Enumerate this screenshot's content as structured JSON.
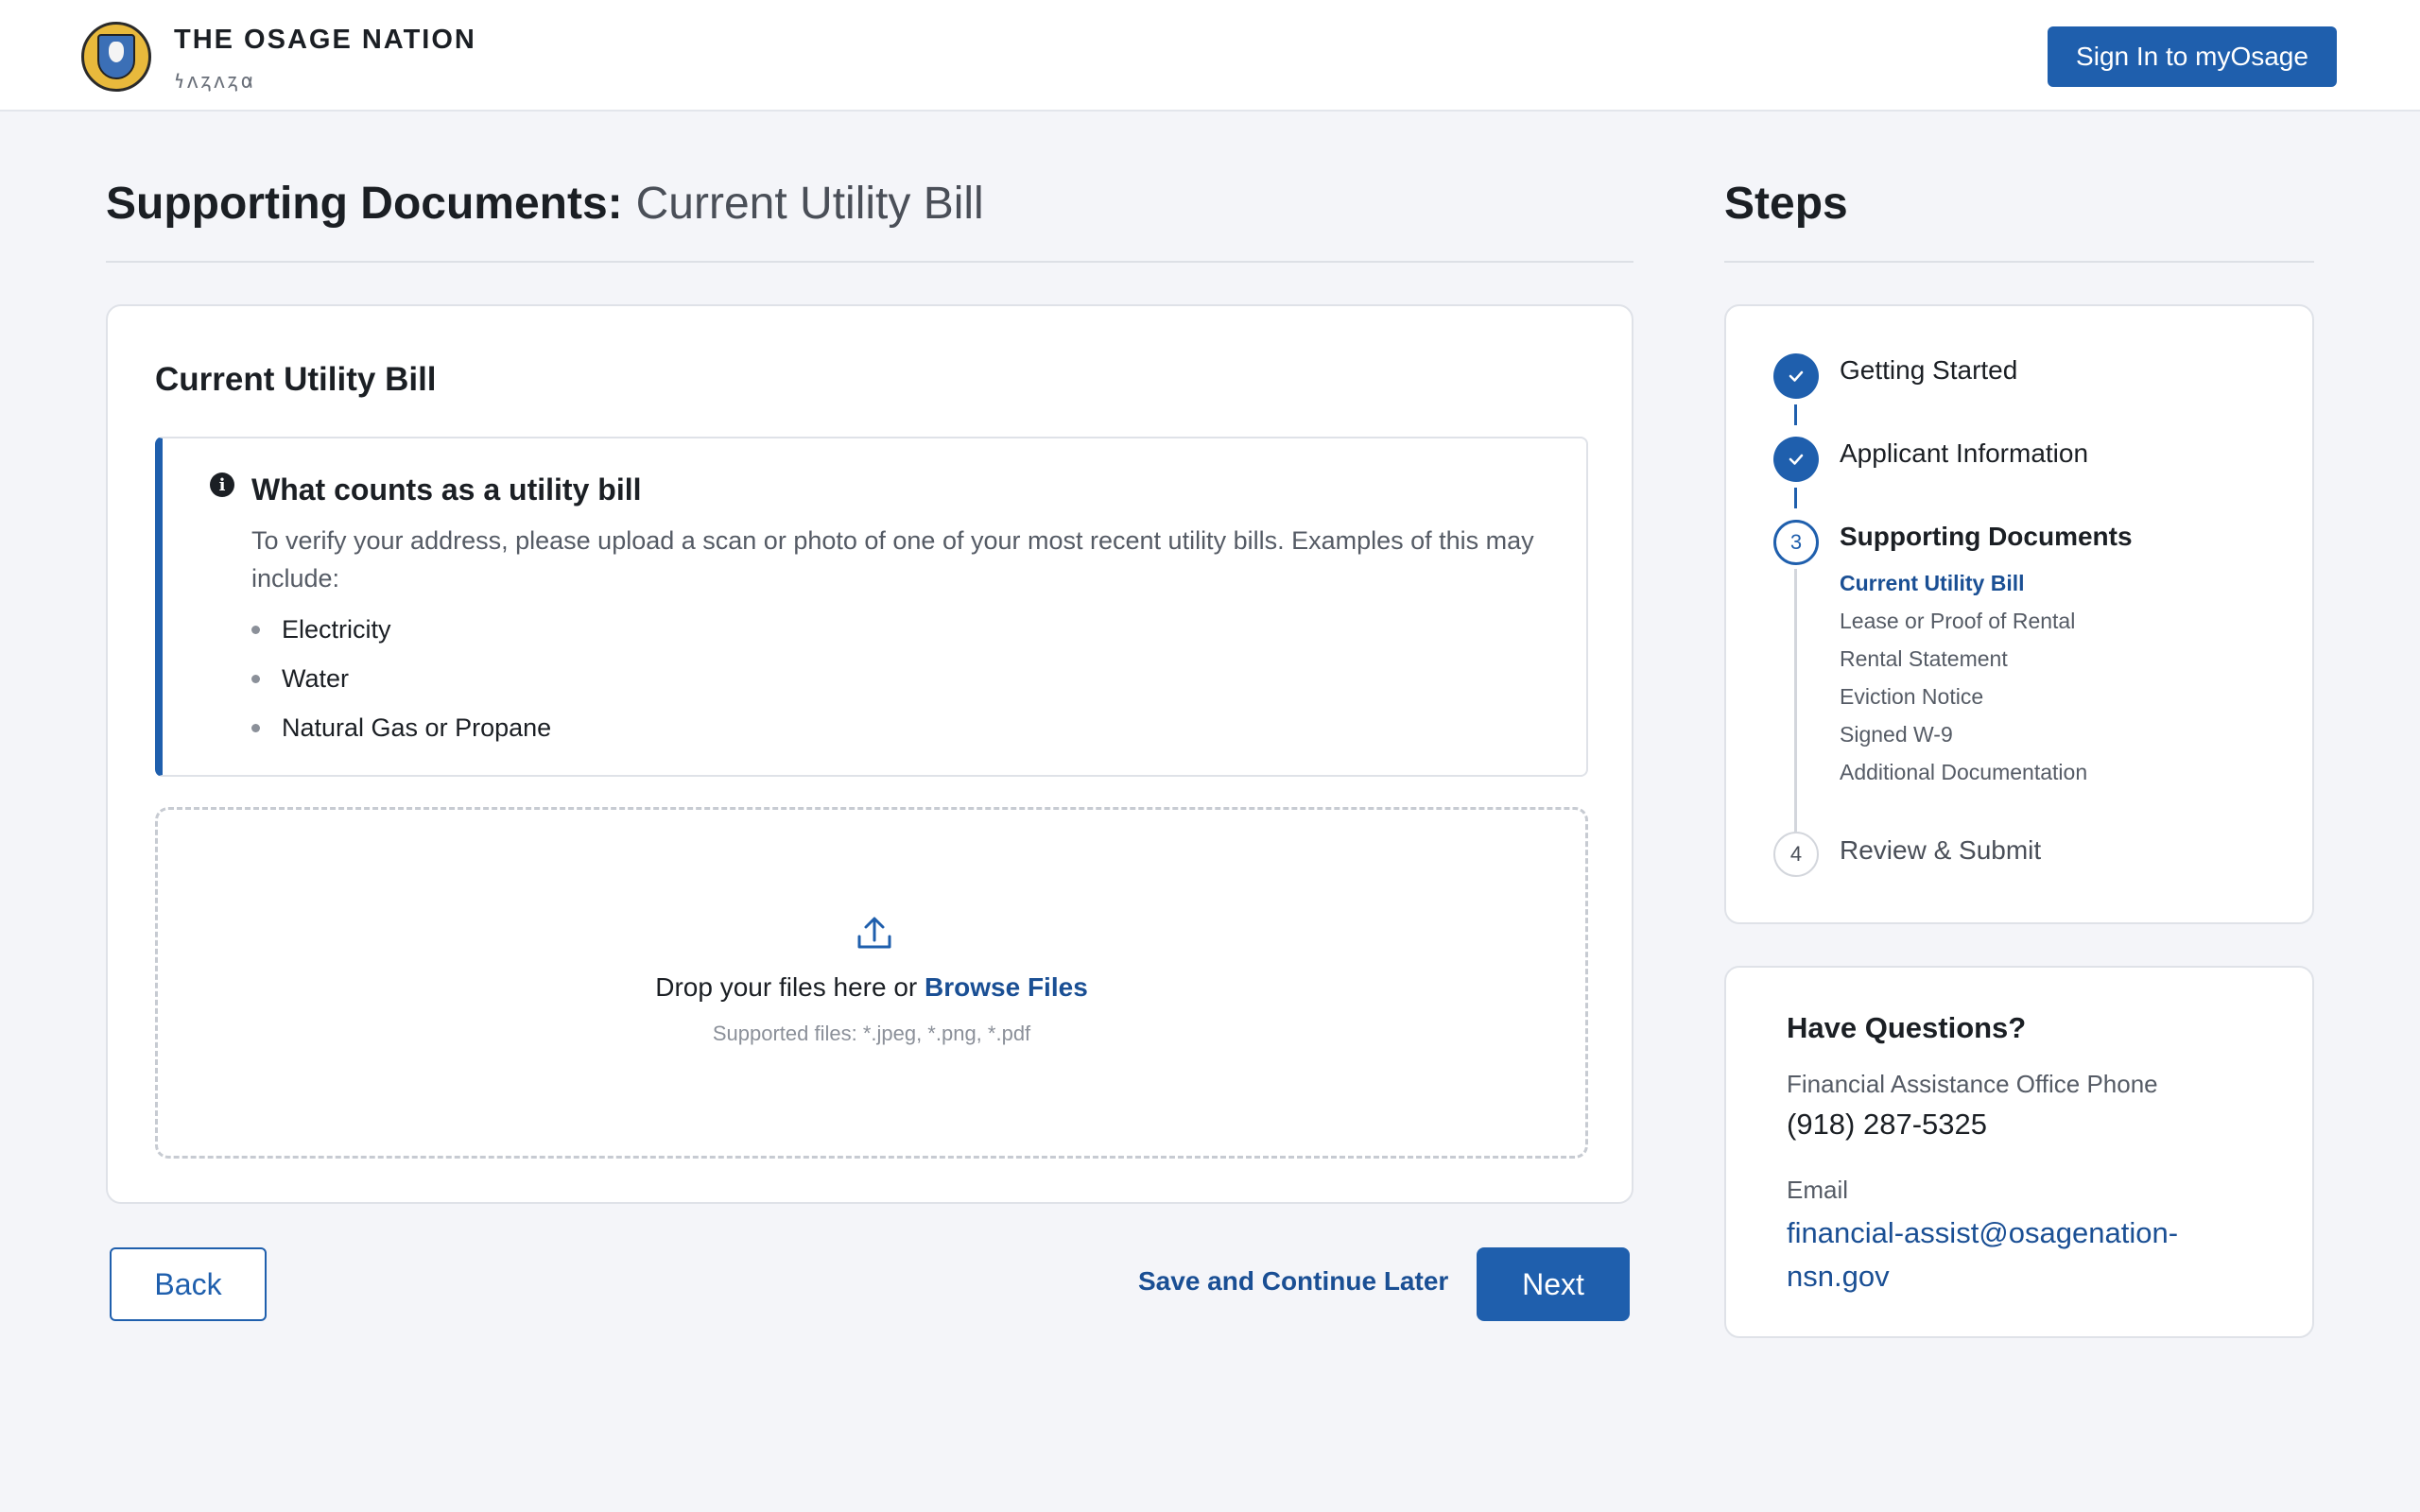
{
  "header": {
    "brand_title": "THE OSAGE NATION",
    "brand_subtitle": "𐓏𐓘𐓻𐓘𐓻𐓟",
    "signin_label": "Sign In to myOsage"
  },
  "page": {
    "title_lead": "Supporting Documents:",
    "title_rest": "Current Utility Bill",
    "steps_title": "Steps"
  },
  "card": {
    "heading": "Current Utility Bill",
    "info": {
      "icon": "info-icon",
      "icon_glyph": "i",
      "title": "What counts as a utility bill",
      "text": "To verify your address, please upload a scan or photo of one of your most recent utility bills. Examples of this may include:",
      "items": [
        "Electricity",
        "Water",
        "Natural Gas or Propane"
      ]
    },
    "dropzone": {
      "text_prefix": "Drop your files here or ",
      "browse_label": "Browse Files",
      "hint": "Supported files: *.jpeg, *.png, *.pdf"
    }
  },
  "actions": {
    "back_label": "Back",
    "save_label": "Save and Continue Later",
    "next_label": "Next"
  },
  "steps": {
    "items": [
      {
        "label": "Getting Started",
        "status": "complete"
      },
      {
        "label": "Applicant Information",
        "status": "complete"
      },
      {
        "label": "Supporting Documents",
        "status": "current",
        "number": "3"
      },
      {
        "label": "Review & Submit",
        "status": "upcoming",
        "number": "4"
      }
    ],
    "substeps": [
      "Current Utility Bill",
      "Lease or Proof of Rental",
      "Rental Statement",
      "Eviction Notice",
      "Signed W-9",
      "Additional Documentation"
    ],
    "active_substep": "Current Utility Bill"
  },
  "questions": {
    "title": "Have Questions?",
    "phone_label": "Financial Assistance Office Phone",
    "phone": "(918) 287-5325",
    "email_label": "Email",
    "email": "financial-assist@osagenation-nsn.gov"
  },
  "colors": {
    "primary": "#1f5fad",
    "link": "#1a4f94",
    "background": "#f4f5f9",
    "seal_gold": "#e8b93c"
  }
}
